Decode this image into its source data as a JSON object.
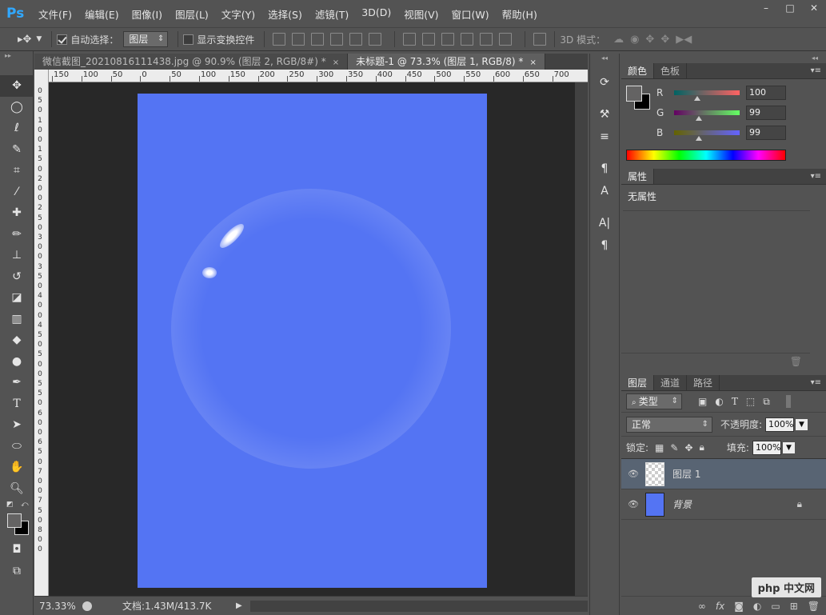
{
  "app": {
    "logo": "Ps"
  },
  "menu": [
    "文件(F)",
    "编辑(E)",
    "图像(I)",
    "图层(L)",
    "文字(Y)",
    "选择(S)",
    "滤镜(T)",
    "3D(D)",
    "视图(V)",
    "窗口(W)",
    "帮助(H)"
  ],
  "window_controls": {
    "minimize": "–",
    "restore": "□",
    "close": "✕"
  },
  "options": {
    "auto_select_label": "自动选择：",
    "auto_select_checked": true,
    "auto_select_value": "图层",
    "transform_label": "显示变换控件",
    "mode3d_label": "3D 模式："
  },
  "tabs": [
    {
      "label": "微信截图_20210816111438.jpg @ 90.9% (图层 2, RGB/8#) *",
      "active": false,
      "close": "×"
    },
    {
      "label": "未标题-1 @ 73.3% (图层 1, RGB/8) *",
      "active": true,
      "close": "×"
    }
  ],
  "ruler_top": [
    "150",
    "100",
    "50",
    "0",
    "50",
    "100",
    "150",
    "200",
    "250",
    "300",
    "350",
    "400",
    "450",
    "500",
    "550",
    "600",
    "650",
    "700"
  ],
  "ruler_left": [
    "0",
    "5",
    "0",
    "1",
    "0",
    "0",
    "1",
    "5",
    "0",
    "2",
    "0",
    "0",
    "2",
    "5",
    "0",
    "3",
    "0",
    "0",
    "3",
    "5",
    "0",
    "4",
    "0",
    "0",
    "4",
    "5",
    "0",
    "5",
    "0",
    "0",
    "5",
    "5",
    "0",
    "6",
    "0",
    "0",
    "6",
    "5",
    "0",
    "7",
    "0",
    "0",
    "7",
    "5",
    "0",
    "8",
    "0",
    "0"
  ],
  "status": {
    "zoom": "73.33%",
    "doc": "文档:1.43M/413.7K"
  },
  "colors": {
    "document_bg": "#5474f3",
    "fg": "#646363",
    "bg": "#000000"
  },
  "color_panel": {
    "tabs": [
      "颜色",
      "色板"
    ],
    "r": {
      "label": "R",
      "value": "100"
    },
    "g": {
      "label": "G",
      "value": "99"
    },
    "b": {
      "label": "B",
      "value": "99"
    }
  },
  "properties_panel": {
    "tab": "属性",
    "text": "无属性"
  },
  "layers_panel": {
    "tabs": [
      "图层",
      "通道",
      "路径"
    ],
    "filter_kind": "类型",
    "blend_mode": "正常",
    "opacity_label": "不透明度:",
    "opacity_value": "100%",
    "lock_label": "锁定:",
    "fill_label": "填充:",
    "fill_value": "100%",
    "layers": [
      {
        "name": "图层 1",
        "selected": true
      },
      {
        "name": "背景",
        "selected": false
      }
    ]
  },
  "watermark": "php 中文网"
}
